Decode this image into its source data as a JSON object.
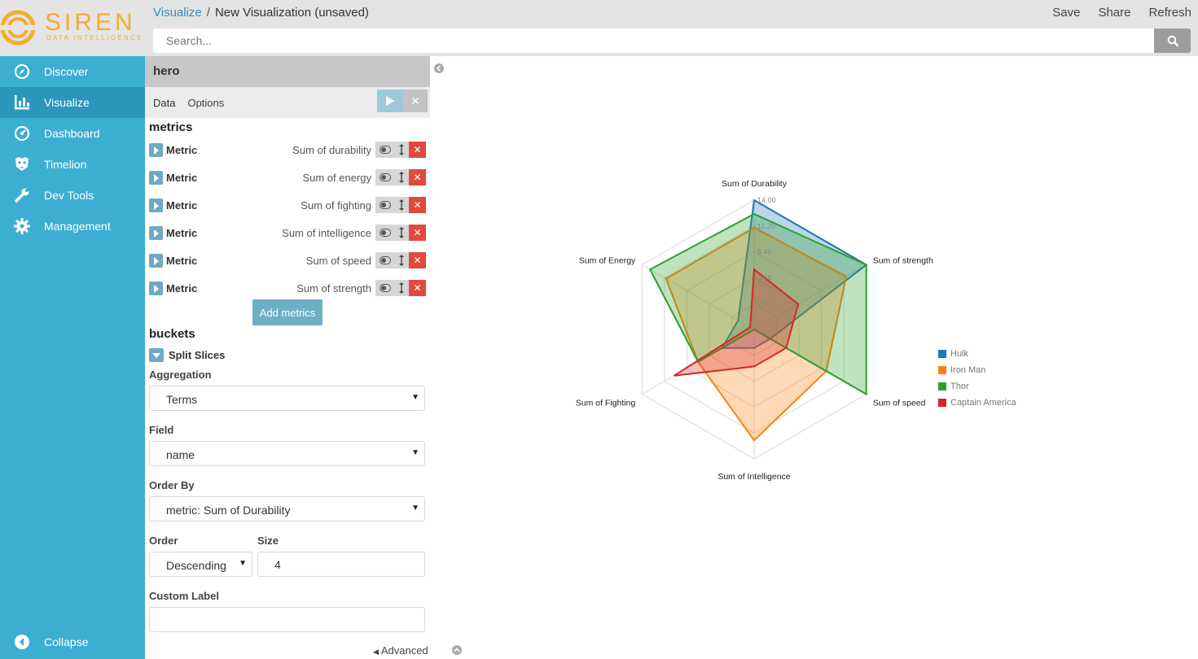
{
  "brand": {
    "name": "SIREN",
    "tagline": "DATA INTELLIGENCE"
  },
  "nav": [
    {
      "label": "Discover",
      "icon": "compass-icon"
    },
    {
      "label": "Visualize",
      "icon": "bar-chart-icon",
      "active": true
    },
    {
      "label": "Dashboard",
      "icon": "gauge-icon"
    },
    {
      "label": "Timelion",
      "icon": "timelion-icon"
    },
    {
      "label": "Dev Tools",
      "icon": "wrench-icon"
    },
    {
      "label": "Management",
      "icon": "gear-icon"
    }
  ],
  "collapse_label": "Collapse",
  "breadcrumb": {
    "root": "Visualize",
    "separator": "/",
    "current": "New Visualization (unsaved)"
  },
  "top_actions": {
    "save": "Save",
    "share": "Share",
    "refresh": "Refresh"
  },
  "search": {
    "placeholder": "Search..."
  },
  "editor": {
    "index": "hero",
    "tabs": {
      "data": "Data",
      "options": "Options"
    },
    "metrics_title": "metrics",
    "metrics": [
      {
        "label": "Metric",
        "value": "Sum of durability"
      },
      {
        "label": "Metric",
        "value": "Sum of energy"
      },
      {
        "label": "Metric",
        "value": "Sum of fighting"
      },
      {
        "label": "Metric",
        "value": "Sum of intelligence"
      },
      {
        "label": "Metric",
        "value": "Sum of speed"
      },
      {
        "label": "Metric",
        "value": "Sum of strength"
      }
    ],
    "add_metrics": "Add metrics",
    "buckets_title": "buckets",
    "split_slices": "Split Slices",
    "aggregation_label": "Aggregation",
    "aggregation_value": "Terms",
    "field_label": "Field",
    "field_value": "name",
    "order_by_label": "Order By",
    "order_by_value": "metric: Sum of Durability",
    "order_label": "Order",
    "order_value": "Descending",
    "size_label": "Size",
    "size_value": "4",
    "custom_label_label": "Custom Label",
    "custom_label_value": "",
    "advanced": "Advanced"
  },
  "chart_data": {
    "type": "radar",
    "axes": [
      "Sum of Durability",
      "Sum of strength",
      "Sum of speed",
      "Sum of Intelligence",
      "Sum of Fighting",
      "Sum of Energy"
    ],
    "ticks": [
      "2.80",
      "5.60",
      "8.40",
      "11.20",
      "14.00"
    ],
    "range": [
      0,
      14
    ],
    "series": [
      {
        "name": "Hulk",
        "color": "#1f77b4",
        "values": [
          14,
          14,
          2,
          2,
          4,
          2
        ]
      },
      {
        "name": "Iron Man",
        "color": "#ff7f0e",
        "values": [
          11,
          11.5,
          9,
          12,
          7,
          11
        ]
      },
      {
        "name": "Thor",
        "color": "#2ca02c",
        "values": [
          12.5,
          14,
          14,
          0,
          7,
          13
        ]
      },
      {
        "name": "Captain America",
        "color": "#d62728",
        "values": [
          6.5,
          5.5,
          4,
          4,
          10,
          0.5
        ]
      }
    ]
  }
}
